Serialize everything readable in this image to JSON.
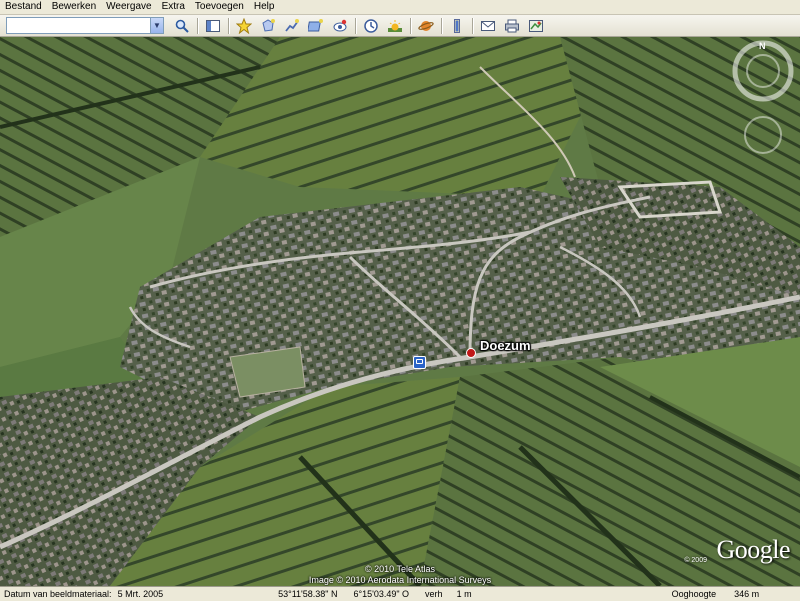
{
  "menu": [
    "Bestand",
    "Bewerken",
    "Weergave",
    "Extra",
    "Toevoegen",
    "Help"
  ],
  "search": {
    "value": "",
    "placeholder": ""
  },
  "toolbar_icons": [
    "search-icon",
    "sidebar-toggle-icon",
    "placemark-icon",
    "polygon-icon",
    "path-icon",
    "image-overlay-icon",
    "record-tour-icon",
    "historical-imagery-icon",
    "sunlight-icon",
    "planet-icon",
    "ruler-icon",
    "email-icon",
    "print-icon",
    "view-in-maps-icon"
  ],
  "map": {
    "place_label": "Doezum",
    "compass_north": "N",
    "copyright_lines": [
      "© 2010 Tele Atlas",
      "Image © 2010 Aerodata International Surveys"
    ],
    "logo_year": "© 2009",
    "logo": "Google"
  },
  "status": {
    "imagery_date_label": "Datum van beeldmateriaal:",
    "imagery_date": "5 Mrt. 2005",
    "latitude": "53°11'58.38\" N",
    "longitude": "6°15'03.49\" O",
    "elevation_label": "verh",
    "elevation": "1 m",
    "eye_alt_label": "Ooghoogte",
    "eye_alt": "346 m"
  },
  "colors": {
    "accent": "#c01818",
    "status_bg": "#ece9d8",
    "field_dark": "#3f5430",
    "field_light": "#6f8a48"
  }
}
